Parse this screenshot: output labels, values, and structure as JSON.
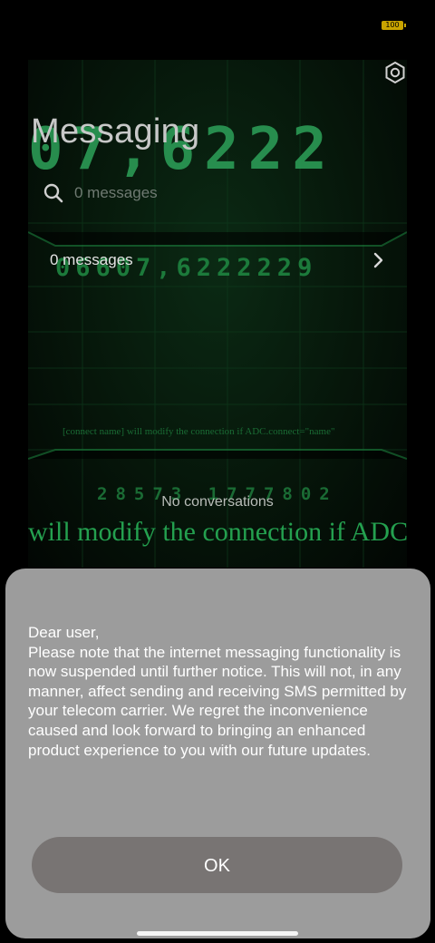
{
  "status_bar": {
    "battery": "100"
  },
  "wallpaper": {
    "big_digits": "07,6222",
    "mid_digits": "06607,6222229",
    "small_digits": "28573 1777802",
    "connect_line": "[connect name] will modify the connection if ADC.connect=\"name\"",
    "big_text": "will modify the connection if ADC."
  },
  "header": {
    "title": "Messaging",
    "settings_icon": "gear-icon"
  },
  "search": {
    "placeholder": "0 messages",
    "icon": "search-icon"
  },
  "messages_row": {
    "label": "0 messages",
    "chevron_icon": "chevron-right-icon"
  },
  "empty_state": {
    "text": "No conversations"
  },
  "dialog": {
    "message": "Dear user,\nPlease note that the internet messaging functionality is now suspended until further notice. This will not, in any manner, affect sending and receiving SMS permitted by your telecom carrier. We regret the inconvenience caused and look forward to bringing an enhanced product experience to you with our future updates.",
    "ok_label": "OK"
  },
  "colors": {
    "background": "#000000",
    "dialog_bg": "#9c9c9c",
    "ok_button_bg": "#787473",
    "battery": "#c9a400",
    "wallpaper_green": "#1f8a44"
  }
}
